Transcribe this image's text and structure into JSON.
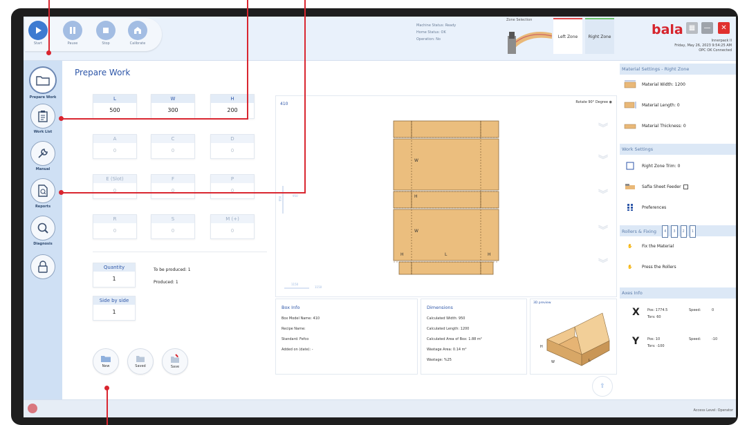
{
  "toolbar": {
    "start": "Start",
    "pause": "Pause",
    "stop": "Stop",
    "calibrate": "Calibrate"
  },
  "machine": {
    "version": "Machine Status: Ready",
    "home": "Home Status: OK",
    "operation": "Operation: No"
  },
  "zone": {
    "selection": "Zone Selection",
    "left": "Left Zone",
    "right": "Right Zone"
  },
  "brand": {
    "logo": "bala"
  },
  "status": {
    "line1": "Innerpack II",
    "line2": "Friday, May 26, 2023 9:54:25 AM",
    "line3": "OPC OK Connected"
  },
  "sidebar": {
    "items": [
      {
        "label": "Prepare Work"
      },
      {
        "label": "Work List"
      },
      {
        "label": "Manual"
      },
      {
        "label": "Reports"
      },
      {
        "label": "Diagnosis"
      },
      {
        "label": ""
      }
    ]
  },
  "page": {
    "title": "Prepare Work"
  },
  "dims": {
    "L": {
      "label": "L",
      "value": "500"
    },
    "W": {
      "label": "W",
      "value": "300"
    },
    "H": {
      "label": "H",
      "value": "200"
    },
    "A": {
      "label": "A",
      "value": "0"
    },
    "C": {
      "label": "C",
      "value": "0"
    },
    "D": {
      "label": "D",
      "value": "0"
    },
    "E": {
      "label": "E (Slot)",
      "value": "0"
    },
    "F": {
      "label": "F",
      "value": "0"
    },
    "P": {
      "label": "P",
      "value": "0"
    },
    "R": {
      "label": "R",
      "value": "0"
    },
    "S": {
      "label": "S",
      "value": "0"
    },
    "M": {
      "label": "M (+)",
      "value": "0"
    }
  },
  "quantity": {
    "label": "Quantity",
    "value": "1"
  },
  "side": {
    "label": "Side by side",
    "value": "1"
  },
  "production": {
    "to_produce": "To be produced:  1",
    "produced": "Produced:  1"
  },
  "actions": {
    "new": "New",
    "saved": "Saved",
    "save": "Save"
  },
  "drawing": {
    "code": "410",
    "rotate": "Rotate 90° Degree",
    "labels": {
      "w": "W",
      "h": "H",
      "l": "L"
    },
    "dim_v": "950",
    "dim_h": "950",
    "dim_bottom": "1150"
  },
  "box_info": {
    "title": "Box Info",
    "model": "Box Model Name:  410",
    "recipe": "Recipe Name:",
    "standard": "Standard:  Fefco",
    "added": "Added on (date):  -"
  },
  "dimensions": {
    "title": "Dimensions",
    "width": "Calculated Width:  950",
    "length": "Calculated Length:  1200",
    "area": "Calculated Area of Box:  1.88 m²",
    "wastage_area": "Wastage Area:  0.14 m²",
    "wastage": "Wastage:  %25"
  },
  "view3d": {
    "title": "3D preview",
    "h": "H",
    "w": "W",
    "l": "L"
  },
  "material": {
    "title": "Material Settings - Right Zone",
    "width": "Material Width:  1200",
    "length": "Material Length:  0",
    "thickness": "Material Thickness:  0"
  },
  "work": {
    "title": "Work Settings",
    "trim": "Right Zone Trim:  0",
    "feeder": "Safia Sheet Feeder",
    "prefs": "Preferences"
  },
  "rollers": {
    "title": "Rollers & Fixing",
    "fix": "Fix the Material",
    "press": "Press the Rollers",
    "nums": [
      "4",
      "3",
      "2",
      "1"
    ]
  },
  "axes": {
    "title": "Axes Info",
    "x": {
      "name": "X",
      "pos_label": "Pos:",
      "pos": "1774.5",
      "tors_label": "Tors:",
      "tors": "60",
      "speed_label": "Speed:",
      "speed": "0"
    },
    "y": {
      "name": "Y",
      "pos_label": "Pos:",
      "pos": "10",
      "tors_label": "Tors:",
      "tors": "-100",
      "speed_label": "Speed:",
      "speed": "-10"
    }
  },
  "footer": {
    "access": "Access Level: Operator"
  },
  "colors": {
    "accent": "#2d56a8",
    "brand": "#d6242c",
    "board": "#e9b878",
    "annotation": "#d9252f"
  }
}
